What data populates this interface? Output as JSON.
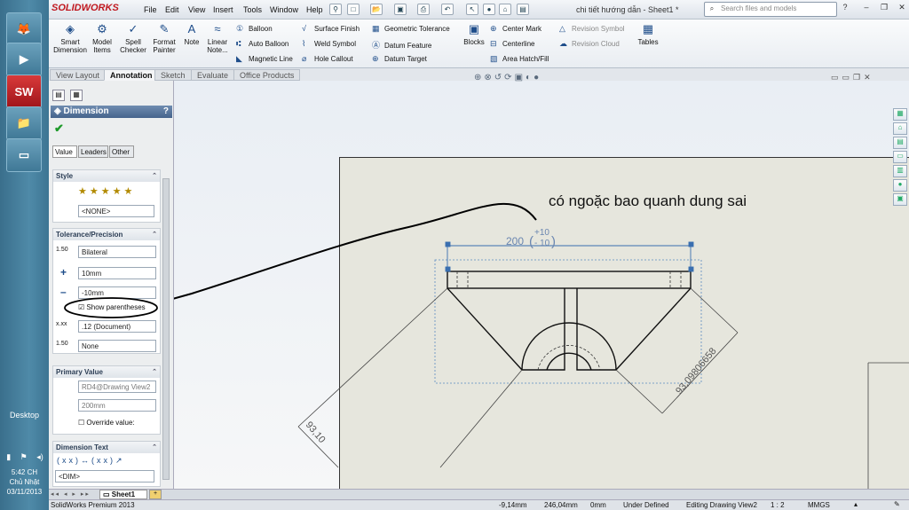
{
  "taskbar": {
    "apps": [
      "Firefox",
      "Media Player",
      "SolidWorks",
      "File Explorer",
      "Screen"
    ],
    "desktop_label": "Desktop",
    "clock_time": "5:42 CH",
    "clock_day": "Chủ Nhật",
    "clock_date": "03/11/2013"
  },
  "titlebar": {
    "brand": "SOLIDWORKS",
    "menus": [
      "File",
      "Edit",
      "View",
      "Insert",
      "Tools",
      "Window",
      "Help"
    ],
    "doc_title": "chi tiết hướng dẫn - Sheet1 *",
    "search_placeholder": "Search files and models"
  },
  "ribbon": {
    "big_buttons": [
      "Smart Dimension",
      "Model Items",
      "Spell Checker",
      "Format Painter",
      "Note",
      "Linear Note..."
    ],
    "col1": [
      "Balloon",
      "Auto Balloon",
      "Magnetic Line"
    ],
    "col2": [
      "Surface Finish",
      "Weld Symbol",
      "Hole Callout"
    ],
    "col3": [
      "Geometric Tolerance",
      "Datum Feature",
      "Datum Target"
    ],
    "blocks": "Blocks",
    "col4": [
      "Center Mark",
      "Centerline",
      "Area Hatch/Fill"
    ],
    "col5": [
      "Revision Symbol",
      "Revision Cloud"
    ],
    "tables": "Tables"
  },
  "tabs": [
    "View Layout",
    "Annotation",
    "Sketch",
    "Evaluate",
    "Office Products"
  ],
  "active_tab": "Annotation",
  "panel": {
    "title": "Dimension",
    "subtabs": [
      "Value",
      "Leaders",
      "Other"
    ],
    "style_head": "Style",
    "style_value": "<NONE>",
    "tol_head": "Tolerance/Precision",
    "tol_type": "Bilateral",
    "upper": "10mm",
    "lower": "-10mm",
    "show_paren": "Show parentheses",
    "precision": ".12 (Document)",
    "precision2": "None",
    "primary_head": "Primary Value",
    "primary_ref": "RD4@Drawing View2",
    "primary_val": "200mm",
    "override": "Override value:",
    "dimtext_head": "Dimension Text",
    "dimtext": "<DIM>"
  },
  "drawing": {
    "note": "có ngoặc bao quanh dung sai",
    "dim_main": "200",
    "tol_plus": "+10",
    "tol_minus": "- 10",
    "dim_diag": "93,09806658",
    "dim_left": "93,10"
  },
  "sheet_tab": "Sheet1",
  "status": {
    "app": "SolidWorks Premium 2013",
    "x": "-9,14mm",
    "y": "246,04mm",
    "z": "0mm",
    "state": "Under Defined",
    "editing": "Editing Drawing View2",
    "scale": "1 : 2",
    "units": "MMGS"
  }
}
